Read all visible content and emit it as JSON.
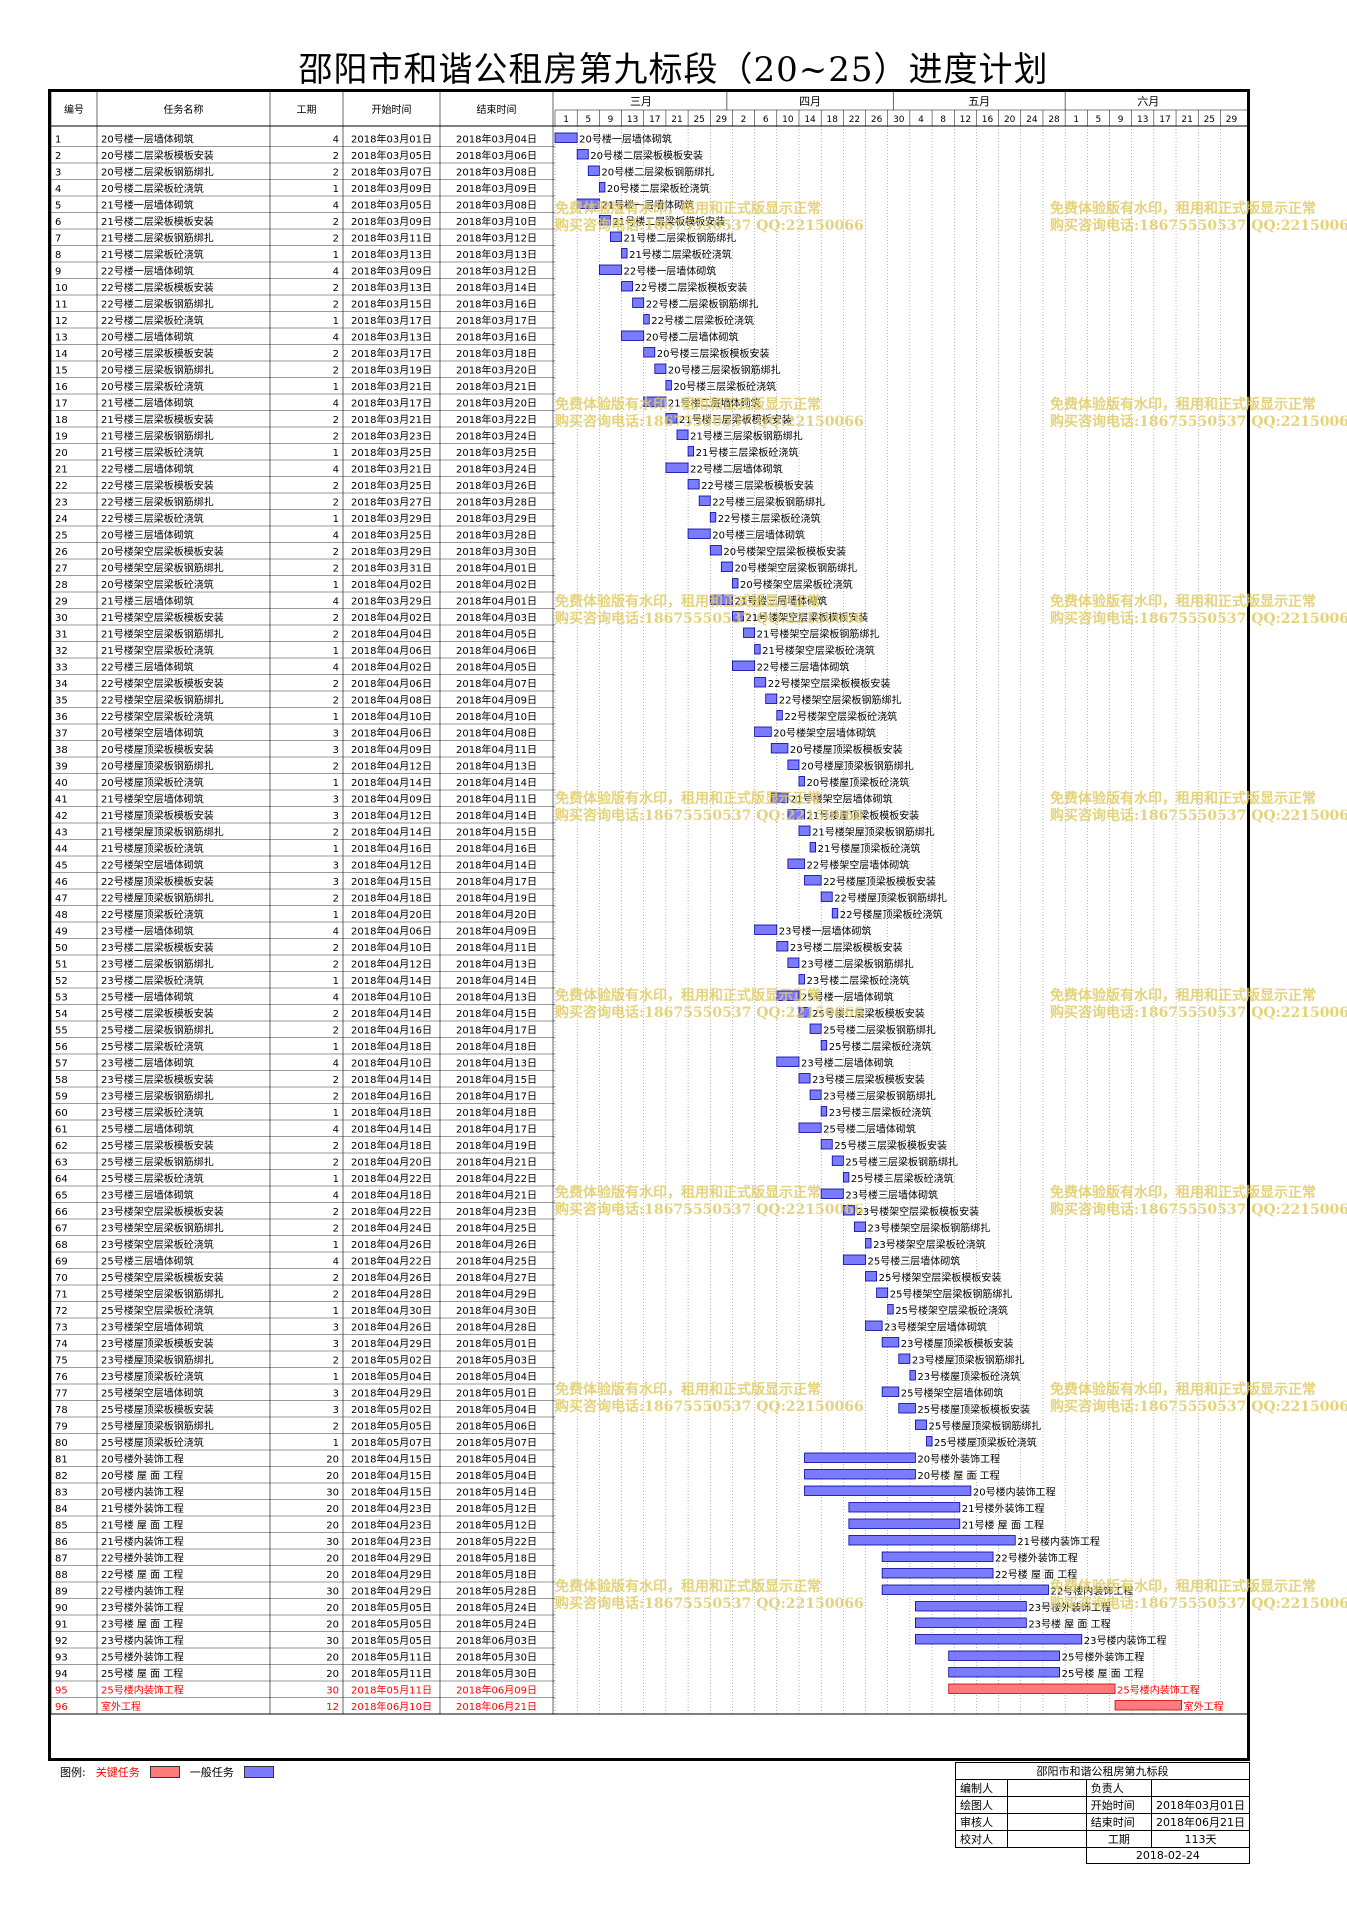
{
  "title": "邵阳市和谐公租房第九标段（20~25）进度计划",
  "headers": {
    "id": "编号",
    "name": "任务名称",
    "dur": "工期",
    "start": "开始时间",
    "end": "结束时间"
  },
  "months": [
    {
      "label": "三月",
      "days": [
        "1",
        "5",
        "9",
        "13",
        "17",
        "21",
        "25",
        "29"
      ]
    },
    {
      "label": "四月",
      "days": [
        "2",
        "6",
        "10",
        "14",
        "18",
        "22",
        "26",
        "30"
      ]
    },
    {
      "label": "五月",
      "days": [
        "4",
        "8",
        "12",
        "16",
        "20",
        "24",
        "28"
      ]
    },
    {
      "label": "六月",
      "days": [
        "1",
        "5",
        "9",
        "13",
        "17",
        "21",
        "25",
        "29"
      ]
    }
  ],
  "watermark": {
    "line1": "免费体验版有水印，租用和正式版显示正常",
    "line2": "购买咨询电话:18675550537 QQ:22150066"
  },
  "legend": {
    "label": "图例:",
    "critical": "关键任务",
    "normal": "一般任务",
    "critical_color": "#ff7b7b",
    "normal_color": "#7b7bff"
  },
  "info": {
    "project": "邵阳市和谐公租房第九标段",
    "editor_label": "编制人",
    "owner_label": "负责人",
    "drawer_label": "绘图人",
    "start_label": "开始时间",
    "start_value": "2018年03月01日",
    "reviewer_label": "审核人",
    "end_label": "结束时间",
    "end_value": "2018年06月21日",
    "checker_label": "校对人",
    "duration_label": "工期",
    "duration_value": "113天",
    "date": "2018-02-24"
  },
  "chart_data": {
    "type": "gantt",
    "axis_start": "2018-03-01",
    "tasks": [
      {
        "id": "1",
        "name": "20号楼一层墙体砌筑",
        "dur": 4,
        "start": "2018年03月01日",
        "end": "2018年03月04日",
        "crit": false
      },
      {
        "id": "2",
        "name": "20号楼二层梁板模板安装",
        "dur": 2,
        "start": "2018年03月05日",
        "end": "2018年03月06日",
        "crit": false
      },
      {
        "id": "3",
        "name": "20号楼二层梁板钢筋绑扎",
        "dur": 2,
        "start": "2018年03月07日",
        "end": "2018年03月08日",
        "crit": false
      },
      {
        "id": "4",
        "name": "20号楼二层梁板砼浇筑",
        "dur": 1,
        "start": "2018年03月09日",
        "end": "2018年03月09日",
        "crit": false
      },
      {
        "id": "5",
        "name": "21号楼一层墙体砌筑",
        "dur": 4,
        "start": "2018年03月05日",
        "end": "2018年03月08日",
        "crit": false
      },
      {
        "id": "6",
        "name": "21号楼二层梁板模板安装",
        "dur": 2,
        "start": "2018年03月09日",
        "end": "2018年03月10日",
        "crit": false
      },
      {
        "id": "7",
        "name": "21号楼二层梁板钢筋绑扎",
        "dur": 2,
        "start": "2018年03月11日",
        "end": "2018年03月12日",
        "crit": false
      },
      {
        "id": "8",
        "name": "21号楼二层梁板砼浇筑",
        "dur": 1,
        "start": "2018年03月13日",
        "end": "2018年03月13日",
        "crit": false
      },
      {
        "id": "9",
        "name": "22号楼一层墙体砌筑",
        "dur": 4,
        "start": "2018年03月09日",
        "end": "2018年03月12日",
        "crit": false
      },
      {
        "id": "10",
        "name": "22号楼二层梁板模板安装",
        "dur": 2,
        "start": "2018年03月13日",
        "end": "2018年03月14日",
        "crit": false
      },
      {
        "id": "11",
        "name": "22号楼二层梁板钢筋绑扎",
        "dur": 2,
        "start": "2018年03月15日",
        "end": "2018年03月16日",
        "crit": false
      },
      {
        "id": "12",
        "name": "22号楼二层梁板砼浇筑",
        "dur": 1,
        "start": "2018年03月17日",
        "end": "2018年03月17日",
        "crit": false
      },
      {
        "id": "13",
        "name": "20号楼二层墙体砌筑",
        "dur": 4,
        "start": "2018年03月13日",
        "end": "2018年03月16日",
        "crit": false
      },
      {
        "id": "14",
        "name": "20号楼三层梁板模板安装",
        "dur": 2,
        "start": "2018年03月17日",
        "end": "2018年03月18日",
        "crit": false
      },
      {
        "id": "15",
        "name": "20号楼三层梁板钢筋绑扎",
        "dur": 2,
        "start": "2018年03月19日",
        "end": "2018年03月20日",
        "crit": false
      },
      {
        "id": "16",
        "name": "20号楼三层梁板砼浇筑",
        "dur": 1,
        "start": "2018年03月21日",
        "end": "2018年03月21日",
        "crit": false
      },
      {
        "id": "17",
        "name": "21号楼二层墙体砌筑",
        "dur": 4,
        "start": "2018年03月17日",
        "end": "2018年03月20日",
        "crit": false
      },
      {
        "id": "18",
        "name": "21号楼三层梁板模板安装",
        "dur": 2,
        "start": "2018年03月21日",
        "end": "2018年03月22日",
        "crit": false
      },
      {
        "id": "19",
        "name": "21号楼三层梁板钢筋绑扎",
        "dur": 2,
        "start": "2018年03月23日",
        "end": "2018年03月24日",
        "crit": false
      },
      {
        "id": "20",
        "name": "21号楼三层梁板砼浇筑",
        "dur": 1,
        "start": "2018年03月25日",
        "end": "2018年03月25日",
        "crit": false
      },
      {
        "id": "21",
        "name": "22号楼二层墙体砌筑",
        "dur": 4,
        "start": "2018年03月21日",
        "end": "2018年03月24日",
        "crit": false
      },
      {
        "id": "22",
        "name": "22号楼三层梁板模板安装",
        "dur": 2,
        "start": "2018年03月25日",
        "end": "2018年03月26日",
        "crit": false
      },
      {
        "id": "23",
        "name": "22号楼三层梁板钢筋绑扎",
        "dur": 2,
        "start": "2018年03月27日",
        "end": "2018年03月28日",
        "crit": false
      },
      {
        "id": "24",
        "name": "22号楼三层梁板砼浇筑",
        "dur": 1,
        "start": "2018年03月29日",
        "end": "2018年03月29日",
        "crit": false
      },
      {
        "id": "25",
        "name": "20号楼三层墙体砌筑",
        "dur": 4,
        "start": "2018年03月25日",
        "end": "2018年03月28日",
        "crit": false
      },
      {
        "id": "26",
        "name": "20号楼架空层梁板模板安装",
        "dur": 2,
        "start": "2018年03月29日",
        "end": "2018年03月30日",
        "crit": false
      },
      {
        "id": "27",
        "name": "20号楼架空层梁板钢筋绑扎",
        "dur": 2,
        "start": "2018年03月31日",
        "end": "2018年04月01日",
        "crit": false
      },
      {
        "id": "28",
        "name": "20号楼架空层梁板砼浇筑",
        "dur": 1,
        "start": "2018年04月02日",
        "end": "2018年04月02日",
        "crit": false
      },
      {
        "id": "29",
        "name": "21号楼三层墙体砌筑",
        "dur": 4,
        "start": "2018年03月29日",
        "end": "2018年04月01日",
        "crit": false
      },
      {
        "id": "30",
        "name": "21号楼架空层梁板模板安装",
        "dur": 2,
        "start": "2018年04月02日",
        "end": "2018年04月03日",
        "crit": false
      },
      {
        "id": "31",
        "name": "21号楼架空层梁板钢筋绑扎",
        "dur": 2,
        "start": "2018年04月04日",
        "end": "2018年04月05日",
        "crit": false
      },
      {
        "id": "32",
        "name": "21号楼架空层梁板砼浇筑",
        "dur": 1,
        "start": "2018年04月06日",
        "end": "2018年04月06日",
        "crit": false
      },
      {
        "id": "33",
        "name": "22号楼三层墙体砌筑",
        "dur": 4,
        "start": "2018年04月02日",
        "end": "2018年04月05日",
        "crit": false
      },
      {
        "id": "34",
        "name": "22号楼架空层梁板模板安装",
        "dur": 2,
        "start": "2018年04月06日",
        "end": "2018年04月07日",
        "crit": false
      },
      {
        "id": "35",
        "name": "22号楼架空层梁板钢筋绑扎",
        "dur": 2,
        "start": "2018年04月08日",
        "end": "2018年04月09日",
        "crit": false
      },
      {
        "id": "36",
        "name": "22号楼架空层梁板砼浇筑",
        "dur": 1,
        "start": "2018年04月10日",
        "end": "2018年04月10日",
        "crit": false
      },
      {
        "id": "37",
        "name": "20号楼架空层墙体砌筑",
        "dur": 3,
        "start": "2018年04月06日",
        "end": "2018年04月08日",
        "crit": false
      },
      {
        "id": "38",
        "name": "20号楼屋顶梁板模板安装",
        "dur": 3,
        "start": "2018年04月09日",
        "end": "2018年04月11日",
        "crit": false
      },
      {
        "id": "39",
        "name": "20号楼屋顶梁板钢筋绑扎",
        "dur": 2,
        "start": "2018年04月12日",
        "end": "2018年04月13日",
        "crit": false
      },
      {
        "id": "40",
        "name": "20号楼屋顶梁板砼浇筑",
        "dur": 1,
        "start": "2018年04月14日",
        "end": "2018年04月14日",
        "crit": false
      },
      {
        "id": "41",
        "name": "21号楼架空层墙体砌筑",
        "dur": 3,
        "start": "2018年04月09日",
        "end": "2018年04月11日",
        "crit": false
      },
      {
        "id": "42",
        "name": "21号楼屋顶梁板模板安装",
        "dur": 3,
        "start": "2018年04月12日",
        "end": "2018年04月14日",
        "crit": false
      },
      {
        "id": "43",
        "name": "21号楼架屋顶梁板钢筋绑扎",
        "dur": 2,
        "start": "2018年04月14日",
        "end": "2018年04月15日",
        "crit": false
      },
      {
        "id": "44",
        "name": "21号楼屋顶梁板砼浇筑",
        "dur": 1,
        "start": "2018年04月16日",
        "end": "2018年04月16日",
        "crit": false
      },
      {
        "id": "45",
        "name": "22号楼架空层墙体砌筑",
        "dur": 3,
        "start": "2018年04月12日",
        "end": "2018年04月14日",
        "crit": false
      },
      {
        "id": "46",
        "name": "22号楼屋顶梁板模板安装",
        "dur": 3,
        "start": "2018年04月15日",
        "end": "2018年04月17日",
        "crit": false
      },
      {
        "id": "47",
        "name": "22号楼屋顶梁板钢筋绑扎",
        "dur": 2,
        "start": "2018年04月18日",
        "end": "2018年04月19日",
        "crit": false
      },
      {
        "id": "48",
        "name": "22号楼屋顶梁板砼浇筑",
        "dur": 1,
        "start": "2018年04月20日",
        "end": "2018年04月20日",
        "crit": false
      },
      {
        "id": "49",
        "name": "23号楼一层墙体砌筑",
        "dur": 4,
        "start": "2018年04月06日",
        "end": "2018年04月09日",
        "crit": false
      },
      {
        "id": "50",
        "name": "23号楼二层梁板模板安装",
        "dur": 2,
        "start": "2018年04月10日",
        "end": "2018年04月11日",
        "crit": false
      },
      {
        "id": "51",
        "name": "23号楼二层梁板钢筋绑扎",
        "dur": 2,
        "start": "2018年04月12日",
        "end": "2018年04月13日",
        "crit": false
      },
      {
        "id": "52",
        "name": "23号楼二层梁板砼浇筑",
        "dur": 1,
        "start": "2018年04月14日",
        "end": "2018年04月14日",
        "crit": false
      },
      {
        "id": "53",
        "name": "25号楼一层墙体砌筑",
        "dur": 4,
        "start": "2018年04月10日",
        "end": "2018年04月13日",
        "crit": false
      },
      {
        "id": "54",
        "name": "25号楼二层梁板模板安装",
        "dur": 2,
        "start": "2018年04月14日",
        "end": "2018年04月15日",
        "crit": false
      },
      {
        "id": "55",
        "name": "25号楼二层梁板钢筋绑扎",
        "dur": 2,
        "start": "2018年04月16日",
        "end": "2018年04月17日",
        "crit": false
      },
      {
        "id": "56",
        "name": "25号楼二层梁板砼浇筑",
        "dur": 1,
        "start": "2018年04月18日",
        "end": "2018年04月18日",
        "crit": false
      },
      {
        "id": "57",
        "name": "23号楼二层墙体砌筑",
        "dur": 4,
        "start": "2018年04月10日",
        "end": "2018年04月13日",
        "crit": false
      },
      {
        "id": "58",
        "name": "23号楼三层梁板模板安装",
        "dur": 2,
        "start": "2018年04月14日",
        "end": "2018年04月15日",
        "crit": false
      },
      {
        "id": "59",
        "name": "23号楼三层梁板钢筋绑扎",
        "dur": 2,
        "start": "2018年04月16日",
        "end": "2018年04月17日",
        "crit": false
      },
      {
        "id": "60",
        "name": "23号楼三层梁板砼浇筑",
        "dur": 1,
        "start": "2018年04月18日",
        "end": "2018年04月18日",
        "crit": false
      },
      {
        "id": "61",
        "name": "25号楼二层墙体砌筑",
        "dur": 4,
        "start": "2018年04月14日",
        "end": "2018年04月17日",
        "crit": false
      },
      {
        "id": "62",
        "name": "25号楼三层梁板模板安装",
        "dur": 2,
        "start": "2018年04月18日",
        "end": "2018年04月19日",
        "crit": false
      },
      {
        "id": "63",
        "name": "25号楼三层梁板钢筋绑扎",
        "dur": 2,
        "start": "2018年04月20日",
        "end": "2018年04月21日",
        "crit": false
      },
      {
        "id": "64",
        "name": "25号楼三层梁板砼浇筑",
        "dur": 1,
        "start": "2018年04月22日",
        "end": "2018年04月22日",
        "crit": false
      },
      {
        "id": "65",
        "name": "23号楼三层墙体砌筑",
        "dur": 4,
        "start": "2018年04月18日",
        "end": "2018年04月21日",
        "crit": false
      },
      {
        "id": "66",
        "name": "23号楼架空层梁板模板安装",
        "dur": 2,
        "start": "2018年04月22日",
        "end": "2018年04月23日",
        "crit": false
      },
      {
        "id": "67",
        "name": "23号楼架空层梁板钢筋绑扎",
        "dur": 2,
        "start": "2018年04月24日",
        "end": "2018年04月25日",
        "crit": false
      },
      {
        "id": "68",
        "name": "23号楼架空层梁板砼浇筑",
        "dur": 1,
        "start": "2018年04月26日",
        "end": "2018年04月26日",
        "crit": false
      },
      {
        "id": "69",
        "name": "25号楼三层墙体砌筑",
        "dur": 4,
        "start": "2018年04月22日",
        "end": "2018年04月25日",
        "crit": false
      },
      {
        "id": "70",
        "name": "25号楼架空层梁板模板安装",
        "dur": 2,
        "start": "2018年04月26日",
        "end": "2018年04月27日",
        "crit": false
      },
      {
        "id": "71",
        "name": "25号楼架空层梁板钢筋绑扎",
        "dur": 2,
        "start": "2018年04月28日",
        "end": "2018年04月29日",
        "crit": false
      },
      {
        "id": "72",
        "name": "25号楼架空层梁板砼浇筑",
        "dur": 1,
        "start": "2018年04月30日",
        "end": "2018年04月30日",
        "crit": false
      },
      {
        "id": "73",
        "name": "23号楼架空层墙体砌筑",
        "dur": 3,
        "start": "2018年04月26日",
        "end": "2018年04月28日",
        "crit": false
      },
      {
        "id": "74",
        "name": "23号楼屋顶梁板模板安装",
        "dur": 3,
        "start": "2018年04月29日",
        "end": "2018年05月01日",
        "crit": false
      },
      {
        "id": "75",
        "name": "23号楼屋顶梁板钢筋绑扎",
        "dur": 2,
        "start": "2018年05月02日",
        "end": "2018年05月03日",
        "crit": false
      },
      {
        "id": "76",
        "name": "23号楼屋顶梁板砼浇筑",
        "dur": 1,
        "start": "2018年05月04日",
        "end": "2018年05月04日",
        "crit": false
      },
      {
        "id": "77",
        "name": "25号楼架空层墙体砌筑",
        "dur": 3,
        "start": "2018年04月29日",
        "end": "2018年05月01日",
        "crit": false
      },
      {
        "id": "78",
        "name": "25号楼屋顶梁板模板安装",
        "dur": 3,
        "start": "2018年05月02日",
        "end": "2018年05月04日",
        "crit": false
      },
      {
        "id": "79",
        "name": "25号楼屋顶梁板钢筋绑扎",
        "dur": 2,
        "start": "2018年05月05日",
        "end": "2018年05月06日",
        "crit": false
      },
      {
        "id": "80",
        "name": "25号楼屋顶梁板砼浇筑",
        "dur": 1,
        "start": "2018年05月07日",
        "end": "2018年05月07日",
        "crit": false
      },
      {
        "id": "81",
        "name": "20号楼外装饰工程",
        "dur": 20,
        "start": "2018年04月15日",
        "end": "2018年05月04日",
        "crit": false
      },
      {
        "id": "82",
        "name": "20号楼 屋 面 工程",
        "dur": 20,
        "start": "2018年04月15日",
        "end": "2018年05月04日",
        "crit": false
      },
      {
        "id": "83",
        "name": "20号楼内装饰工程",
        "dur": 30,
        "start": "2018年04月15日",
        "end": "2018年05月14日",
        "crit": false
      },
      {
        "id": "84",
        "name": "21号楼外装饰工程",
        "dur": 20,
        "start": "2018年04月23日",
        "end": "2018年05月12日",
        "crit": false
      },
      {
        "id": "85",
        "name": "21号楼 屋 面 工程",
        "dur": 20,
        "start": "2018年04月23日",
        "end": "2018年05月12日",
        "crit": false
      },
      {
        "id": "86",
        "name": "21号楼内装饰工程",
        "dur": 30,
        "start": "2018年04月23日",
        "end": "2018年05月22日",
        "crit": false
      },
      {
        "id": "87",
        "name": "22号楼外装饰工程",
        "dur": 20,
        "start": "2018年04月29日",
        "end": "2018年05月18日",
        "crit": false
      },
      {
        "id": "88",
        "name": "22号楼 屋 面 工程",
        "dur": 20,
        "start": "2018年04月29日",
        "end": "2018年05月18日",
        "crit": false
      },
      {
        "id": "89",
        "name": "22号楼内装饰工程",
        "dur": 30,
        "start": "2018年04月29日",
        "end": "2018年05月28日",
        "crit": false
      },
      {
        "id": "90",
        "name": "23号楼外装饰工程",
        "dur": 20,
        "start": "2018年05月05日",
        "end": "2018年05月24日",
        "crit": false
      },
      {
        "id": "91",
        "name": "23号楼 屋 面 工程",
        "dur": 20,
        "start": "2018年05月05日",
        "end": "2018年05月24日",
        "crit": false
      },
      {
        "id": "92",
        "name": "23号楼内装饰工程",
        "dur": 30,
        "start": "2018年05月05日",
        "end": "2018年06月03日",
        "crit": false
      },
      {
        "id": "93",
        "name": "25号楼外装饰工程",
        "dur": 20,
        "start": "2018年05月11日",
        "end": "2018年05月30日",
        "crit": false
      },
      {
        "id": "94",
        "name": "25号楼 屋 面 工程",
        "dur": 20,
        "start": "2018年05月11日",
        "end": "2018年05月30日",
        "crit": false
      },
      {
        "id": "95",
        "name": "25号楼内装饰工程",
        "dur": 30,
        "start": "2018年05月11日",
        "end": "2018年06月09日",
        "crit": true
      },
      {
        "id": "96",
        "name": "室外工程",
        "dur": 12,
        "start": "2018年06月10日",
        "end": "2018年06月21日",
        "crit": true
      }
    ]
  }
}
